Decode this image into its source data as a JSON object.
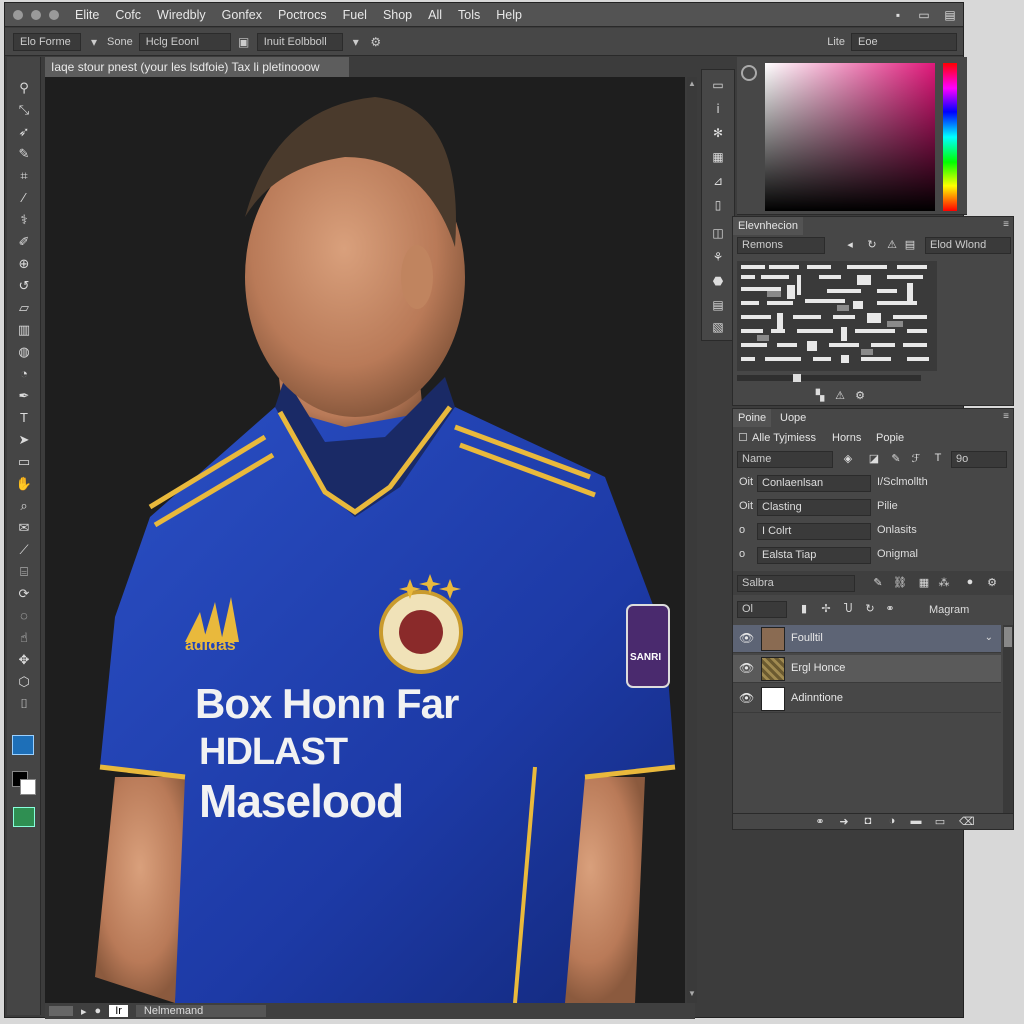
{
  "menu": [
    "Elite",
    "Cofc",
    "Wiredbly",
    "Gonfex",
    "Poctrocs",
    "Fuel",
    "Shop",
    "All",
    "Tols",
    "Help"
  ],
  "window_controls": [
    "▪",
    "▭",
    "▤"
  ],
  "options_bar": {
    "preset": "Elo Forme",
    "size_label": "Sone",
    "size_value": "Hclg Eoonl",
    "style_value": "Inuit Eolbboll",
    "right_label": "Lite",
    "right_field": "Eoe"
  },
  "document": {
    "tab_title": "Iaqe stour pnest (your les lsdfoie) Tax li pletinooow",
    "jersey_text": [
      "Box Honn Far",
      "HDLAST",
      "Maselood"
    ],
    "brand": "adidas",
    "badge_text": "SANRI",
    "status_left": "Ir",
    "status_name": "Nelmemand"
  },
  "nav_panel": {
    "tab": "Elevnhecion",
    "dropdown": "Remons",
    "right_field": "Elod Wlond"
  },
  "layers_panel": {
    "tabs": [
      "Poine",
      "Uope"
    ],
    "subtabs": [
      "Alle Tyjmiess",
      "Horns",
      "Popie"
    ],
    "filter_field": "Name",
    "filter_value": "9o",
    "props": [
      {
        "label": "Oit",
        "field": "Conlaenlsan",
        "value": "I/Sclmollth"
      },
      {
        "label": "Oit",
        "field": "Clasting",
        "value": "Pilie"
      },
      {
        "label": "o",
        "field": "I Colrt",
        "value": "Onlasits"
      },
      {
        "label": "o",
        "field": "Ealsta Tiap",
        "value": "Onigmal"
      }
    ],
    "blend_mode": "Salbra",
    "opacity_field": "Ol",
    "lock_label": "Magram",
    "layers": [
      {
        "name": "Foulltil",
        "thumb": "#8a6b52",
        "selected": true
      },
      {
        "name": "Ergl Honce",
        "thumb": "#7a6a3a",
        "selected": false
      },
      {
        "name": "Adinntione",
        "thumb": "#ffffff",
        "selected": false
      }
    ]
  }
}
